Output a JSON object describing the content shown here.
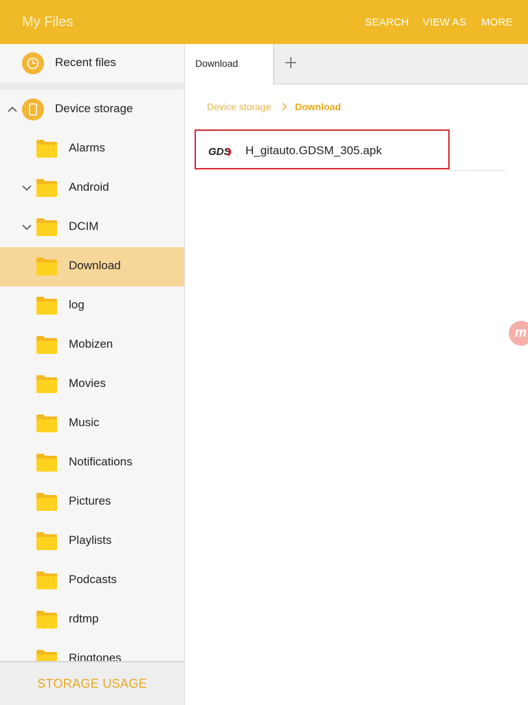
{
  "app": {
    "title": "My Files"
  },
  "appbar": {
    "actions": [
      "SEARCH",
      "VIEW AS",
      "MORE"
    ]
  },
  "sidebar": {
    "recent_label": "Recent files",
    "storage_label": "Device storage",
    "folders": [
      {
        "label": "Alarms",
        "chevron": ""
      },
      {
        "label": "Android",
        "chevron": "down"
      },
      {
        "label": "DCIM",
        "chevron": "down"
      },
      {
        "label": "Download",
        "chevron": "",
        "selected": true
      },
      {
        "label": "log",
        "chevron": ""
      },
      {
        "label": "Mobizen",
        "chevron": ""
      },
      {
        "label": "Movies",
        "chevron": ""
      },
      {
        "label": "Music",
        "chevron": ""
      },
      {
        "label": "Notifications",
        "chevron": ""
      },
      {
        "label": "Pictures",
        "chevron": ""
      },
      {
        "label": "Playlists",
        "chevron": ""
      },
      {
        "label": "Podcasts",
        "chevron": ""
      },
      {
        "label": "rdtmp",
        "chevron": ""
      },
      {
        "label": "Ringtones",
        "chevron": ""
      }
    ],
    "storage_usage_label": "STORAGE USAGE"
  },
  "tabs": {
    "active_label": "Download"
  },
  "breadcrumb": {
    "items": [
      "Device storage",
      "Download"
    ]
  },
  "files": [
    {
      "name": "H_gitauto.GDSM_305.apk",
      "icon": "GDS"
    }
  ],
  "floating": {
    "label": "m"
  },
  "colors": {
    "accent": "#f0b927",
    "selected_row": "#f7d799",
    "highlight_border": "#d6262e",
    "crumb_active": "#e8a91f"
  }
}
